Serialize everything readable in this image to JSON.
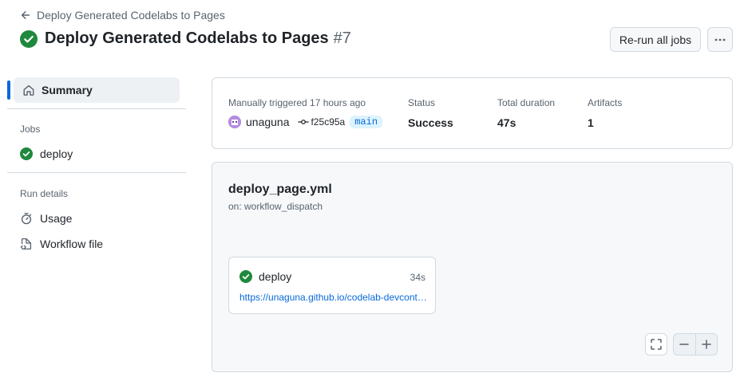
{
  "header": {
    "back_label": "Deploy Generated Codelabs to Pages",
    "title": "Deploy Generated Codelabs to Pages",
    "run_number": "#7",
    "rerun_label": "Re-run all jobs"
  },
  "sidebar": {
    "summary_label": "Summary",
    "jobs_heading": "Jobs",
    "jobs": [
      {
        "label": "deploy"
      }
    ],
    "run_details_heading": "Run details",
    "run_details": [
      {
        "label": "Usage"
      },
      {
        "label": "Workflow file"
      }
    ]
  },
  "summary": {
    "trigger_label": "Manually triggered 17 hours ago",
    "user": "unaguna",
    "commit": "f25c95a",
    "branch": "main",
    "status_label": "Status",
    "status_value": "Success",
    "duration_label": "Total duration",
    "duration_value": "47s",
    "artifacts_label": "Artifacts",
    "artifacts_value": "1"
  },
  "workflow": {
    "file": "deploy_page.yml",
    "trigger": "on: workflow_dispatch",
    "job": {
      "name": "deploy",
      "duration": "34s",
      "url": "https://unaguna.github.io/codelab-devcontainer/"
    }
  },
  "colors": {
    "success": "#1f883d",
    "accent": "#0969da",
    "border": "#d1d9e0"
  }
}
